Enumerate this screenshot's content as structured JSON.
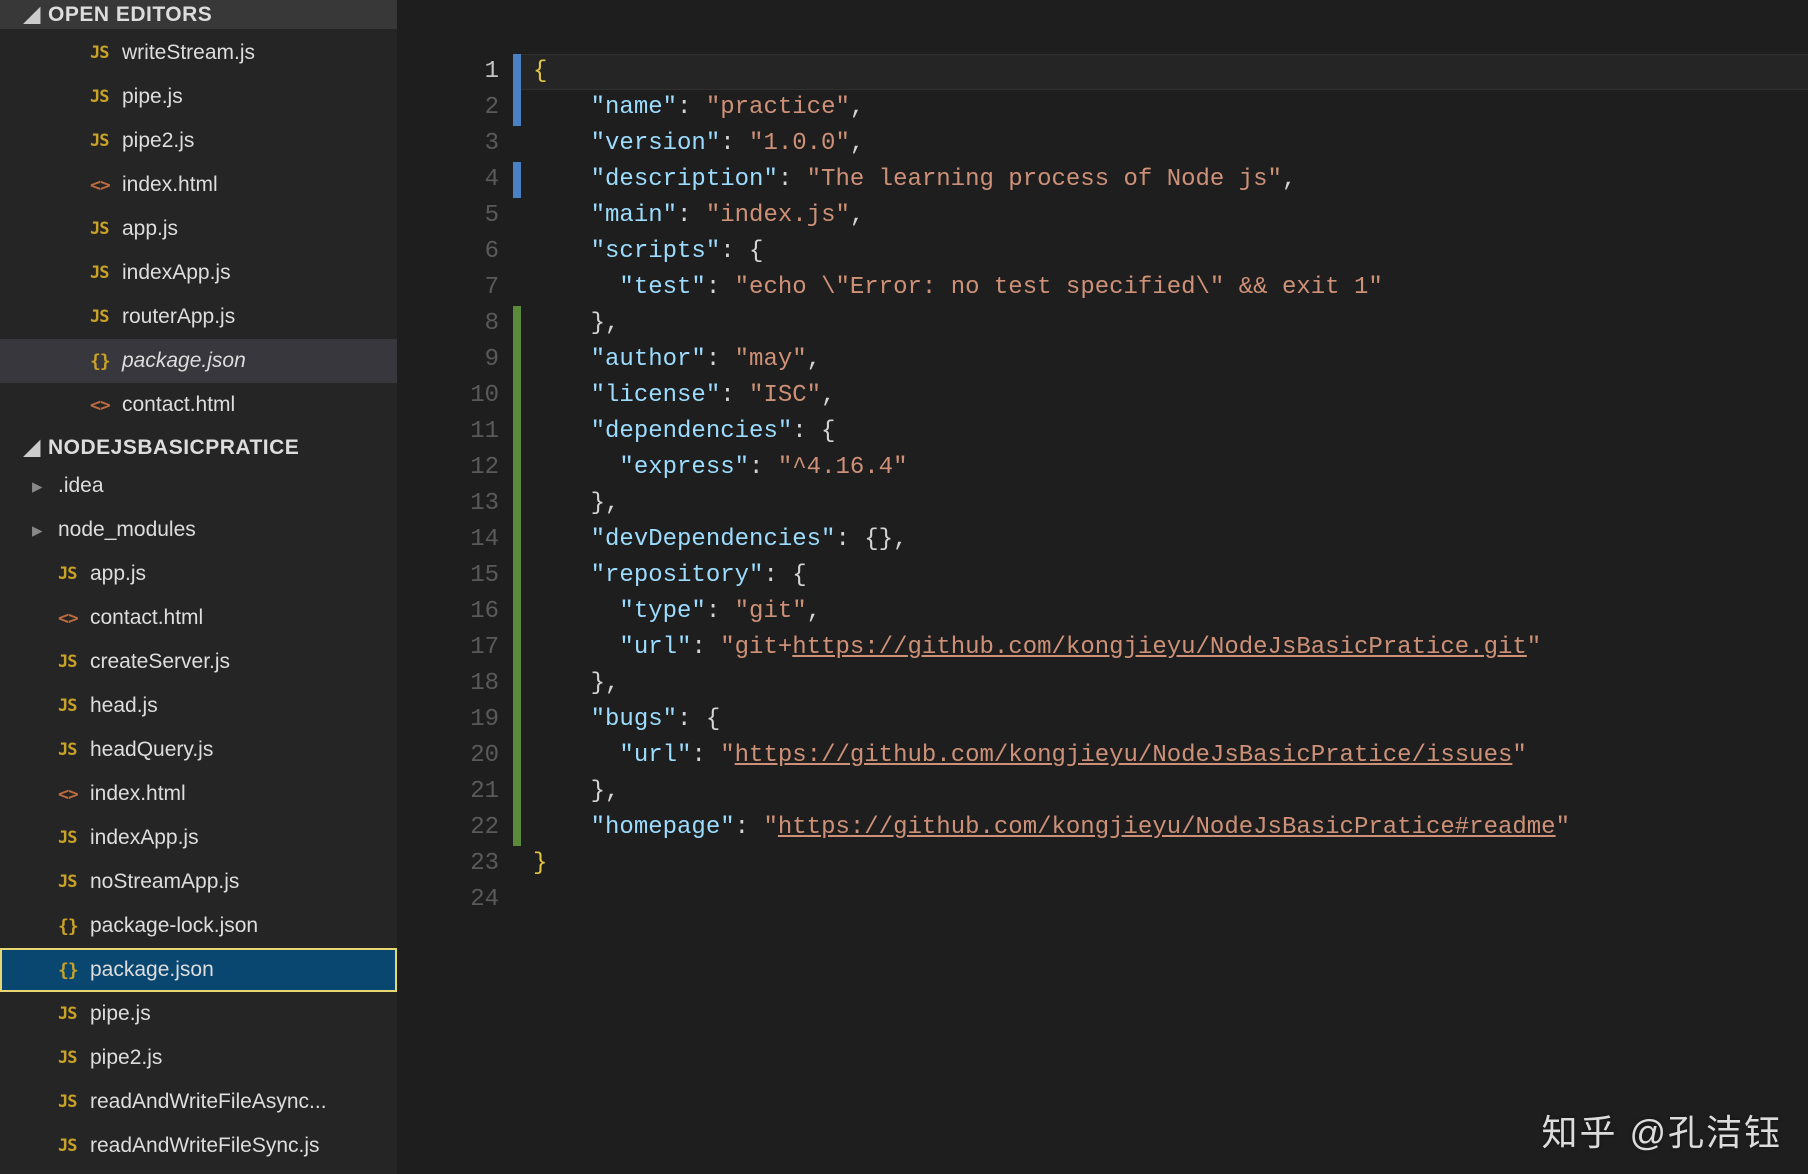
{
  "sidebar": {
    "sectionOpenEditors": "OPEN EDITORS",
    "sectionProject": "NODEJSBASICPRATICE",
    "openEditors": [
      {
        "icon": "js",
        "name": "writeStream.js"
      },
      {
        "icon": "js",
        "name": "pipe.js"
      },
      {
        "icon": "js",
        "name": "pipe2.js"
      },
      {
        "icon": "htm",
        "name": "index.html"
      },
      {
        "icon": "js",
        "name": "app.js"
      },
      {
        "icon": "js",
        "name": "indexApp.js"
      },
      {
        "icon": "js",
        "name": "routerApp.js"
      },
      {
        "icon": "bra",
        "name": "package.json",
        "active": true
      },
      {
        "icon": "htm",
        "name": "contact.html"
      }
    ],
    "project": [
      {
        "folder": true,
        "name": ".idea"
      },
      {
        "folder": true,
        "name": "node_modules"
      },
      {
        "icon": "js",
        "name": "app.js"
      },
      {
        "icon": "htm",
        "name": "contact.html"
      },
      {
        "icon": "js",
        "name": "createServer.js"
      },
      {
        "icon": "js",
        "name": "head.js"
      },
      {
        "icon": "js",
        "name": "headQuery.js"
      },
      {
        "icon": "htm",
        "name": "index.html"
      },
      {
        "icon": "js",
        "name": "indexApp.js"
      },
      {
        "icon": "js",
        "name": "noStreamApp.js"
      },
      {
        "icon": "bra",
        "name": "package-lock.json"
      },
      {
        "icon": "bra",
        "name": "package.json",
        "selected": true
      },
      {
        "icon": "js",
        "name": "pipe.js"
      },
      {
        "icon": "js",
        "name": "pipe2.js"
      },
      {
        "icon": "js",
        "name": "readAndWriteFileAsync..."
      },
      {
        "icon": "js",
        "name": "readAndWriteFileSync.js"
      }
    ]
  },
  "editor": {
    "currentLine": 1,
    "dirty": [
      "b",
      "b",
      "",
      "b",
      "",
      "",
      "",
      "g",
      "g",
      "g",
      "g",
      "g",
      "g",
      "g",
      "g",
      "g",
      "g",
      "g",
      "g",
      "g",
      "g",
      "g",
      "",
      ""
    ],
    "lines": [
      [
        {
          "cls": "t-brace",
          "t": "{"
        }
      ],
      [
        {
          "cls": "t-punct",
          "t": "    "
        },
        {
          "cls": "t-key",
          "t": "\"name\""
        },
        {
          "cls": "t-punct",
          "t": ": "
        },
        {
          "cls": "t-str",
          "t": "\"practice\""
        },
        {
          "cls": "t-punct",
          "t": ","
        }
      ],
      [
        {
          "cls": "t-punct",
          "t": "    "
        },
        {
          "cls": "t-key",
          "t": "\"version\""
        },
        {
          "cls": "t-punct",
          "t": ": "
        },
        {
          "cls": "t-str",
          "t": "\"1.0.0\""
        },
        {
          "cls": "t-punct",
          "t": ","
        }
      ],
      [
        {
          "cls": "t-punct",
          "t": "    "
        },
        {
          "cls": "t-key",
          "t": "\"description\""
        },
        {
          "cls": "t-punct",
          "t": ": "
        },
        {
          "cls": "t-str",
          "t": "\"The learning process of Node js\""
        },
        {
          "cls": "t-punct",
          "t": ","
        }
      ],
      [
        {
          "cls": "t-punct",
          "t": "    "
        },
        {
          "cls": "t-key",
          "t": "\"main\""
        },
        {
          "cls": "t-punct",
          "t": ": "
        },
        {
          "cls": "t-str",
          "t": "\"index.js\""
        },
        {
          "cls": "t-punct",
          "t": ","
        }
      ],
      [
        {
          "cls": "t-punct",
          "t": "    "
        },
        {
          "cls": "t-key",
          "t": "\"scripts\""
        },
        {
          "cls": "t-punct",
          "t": ": {"
        }
      ],
      [
        {
          "cls": "t-punct",
          "t": "      "
        },
        {
          "cls": "t-key",
          "t": "\"test\""
        },
        {
          "cls": "t-punct",
          "t": ": "
        },
        {
          "cls": "t-str",
          "t": "\"echo \\\"Error: no test specified\\\" && exit 1\""
        }
      ],
      [
        {
          "cls": "t-punct",
          "t": "    },"
        }
      ],
      [
        {
          "cls": "t-punct",
          "t": "    "
        },
        {
          "cls": "t-key",
          "t": "\"author\""
        },
        {
          "cls": "t-punct",
          "t": ": "
        },
        {
          "cls": "t-str",
          "t": "\"may\""
        },
        {
          "cls": "t-punct",
          "t": ","
        }
      ],
      [
        {
          "cls": "t-punct",
          "t": "    "
        },
        {
          "cls": "t-key",
          "t": "\"license\""
        },
        {
          "cls": "t-punct",
          "t": ": "
        },
        {
          "cls": "t-str",
          "t": "\"ISC\""
        },
        {
          "cls": "t-punct",
          "t": ","
        }
      ],
      [
        {
          "cls": "t-punct",
          "t": "    "
        },
        {
          "cls": "t-key",
          "t": "\"dependencies\""
        },
        {
          "cls": "t-punct",
          "t": ": {"
        }
      ],
      [
        {
          "cls": "t-punct",
          "t": "      "
        },
        {
          "cls": "t-key",
          "t": "\"express\""
        },
        {
          "cls": "t-punct",
          "t": ": "
        },
        {
          "cls": "t-str",
          "t": "\"^4.16.4\""
        }
      ],
      [
        {
          "cls": "t-punct",
          "t": "    },"
        }
      ],
      [
        {
          "cls": "t-punct",
          "t": "    "
        },
        {
          "cls": "t-key",
          "t": "\"devDependencies\""
        },
        {
          "cls": "t-punct",
          "t": ": {},"
        }
      ],
      [
        {
          "cls": "t-punct",
          "t": "    "
        },
        {
          "cls": "t-key",
          "t": "\"repository\""
        },
        {
          "cls": "t-punct",
          "t": ": {"
        }
      ],
      [
        {
          "cls": "t-punct",
          "t": "      "
        },
        {
          "cls": "t-key",
          "t": "\"type\""
        },
        {
          "cls": "t-punct",
          "t": ": "
        },
        {
          "cls": "t-str",
          "t": "\"git\""
        },
        {
          "cls": "t-punct",
          "t": ","
        }
      ],
      [
        {
          "cls": "t-punct",
          "t": "      "
        },
        {
          "cls": "t-key",
          "t": "\"url\""
        },
        {
          "cls": "t-punct",
          "t": ": "
        },
        {
          "cls": "t-str",
          "t": "\"git+"
        },
        {
          "cls": "t-link",
          "t": "https://github.com/kongjieyu/NodeJsBasicPratice.git"
        },
        {
          "cls": "t-str",
          "t": "\""
        }
      ],
      [
        {
          "cls": "t-punct",
          "t": "    },"
        }
      ],
      [
        {
          "cls": "t-punct",
          "t": "    "
        },
        {
          "cls": "t-key",
          "t": "\"bugs\""
        },
        {
          "cls": "t-punct",
          "t": ": {"
        }
      ],
      [
        {
          "cls": "t-punct",
          "t": "      "
        },
        {
          "cls": "t-key",
          "t": "\"url\""
        },
        {
          "cls": "t-punct",
          "t": ": "
        },
        {
          "cls": "t-str",
          "t": "\""
        },
        {
          "cls": "t-link",
          "t": "https://github.com/kongjieyu/NodeJsBasicPratice/issues"
        },
        {
          "cls": "t-str",
          "t": "\""
        }
      ],
      [
        {
          "cls": "t-punct",
          "t": "    },"
        }
      ],
      [
        {
          "cls": "t-punct",
          "t": "    "
        },
        {
          "cls": "t-key",
          "t": "\"homepage\""
        },
        {
          "cls": "t-punct",
          "t": ": "
        },
        {
          "cls": "t-str",
          "t": "\""
        },
        {
          "cls": "t-link",
          "t": "https://github.com/kongjieyu/NodeJsBasicPratice#readme"
        },
        {
          "cls": "t-str",
          "t": "\""
        }
      ],
      [
        {
          "cls": "t-brace",
          "t": "}"
        }
      ],
      []
    ]
  },
  "watermark": "知乎 @孔洁钰"
}
